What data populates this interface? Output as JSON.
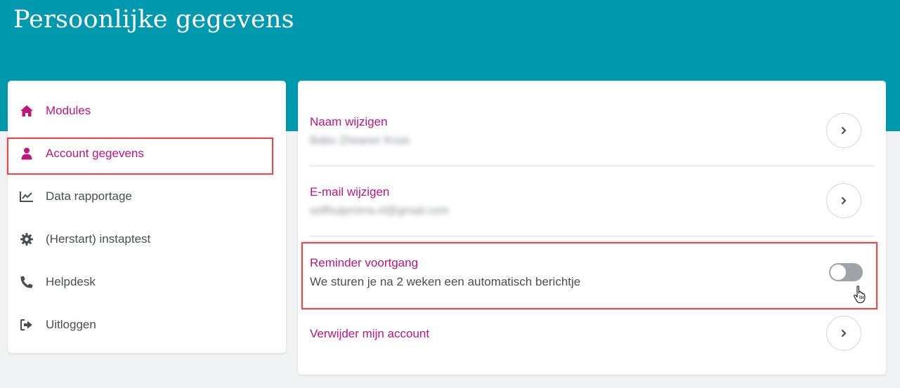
{
  "header": {
    "title": "Persoonlijke gegevens"
  },
  "colors": {
    "brand_teal": "#0099ae",
    "accent_magenta": "#c0147f",
    "highlight_red": "#e8474a"
  },
  "sidebar": {
    "items": [
      {
        "label": "Modules",
        "icon": "home-icon"
      },
      {
        "label": "Account gegevens",
        "icon": "user-icon",
        "active": true
      },
      {
        "label": "Data rapportage",
        "icon": "chart-line-icon"
      },
      {
        "label": "(Herstart) instaptest",
        "icon": "gear-icon"
      },
      {
        "label": "Helpdesk",
        "icon": "phone-icon"
      },
      {
        "label": "Uitloggen",
        "icon": "sign-out-icon"
      }
    ]
  },
  "main": {
    "name": {
      "title": "Naam wijzigen",
      "value": "Babu Zheaner Kruis"
    },
    "email": {
      "title": "E-mail wijzigen",
      "value": "selfhulpmirra.nl@gmail.com"
    },
    "reminder": {
      "title": "Reminder voortgang",
      "description": "We sturen je na 2 weken een automatisch berichtje",
      "enabled": false
    },
    "delete": {
      "title": "Verwijder mijn account"
    }
  }
}
